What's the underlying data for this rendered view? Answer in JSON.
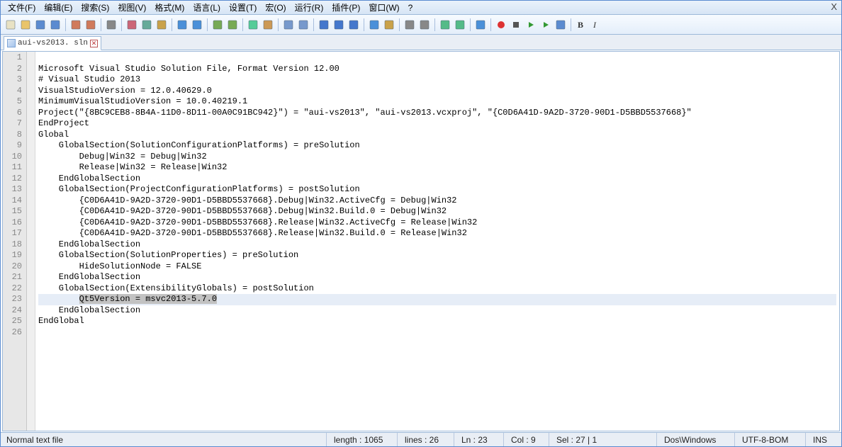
{
  "menu": [
    "文件(F)",
    "编辑(E)",
    "搜索(S)",
    "视图(V)",
    "格式(M)",
    "语言(L)",
    "设置(T)",
    "宏(O)",
    "运行(R)",
    "插件(P)",
    "窗口(W)",
    "?"
  ],
  "close_x": "X",
  "tab": {
    "name": "aui-vs2013. sln"
  },
  "toolbar_icons": [
    "new",
    "open",
    "save",
    "saveall",
    "sep",
    "close",
    "closeall",
    "sep",
    "print",
    "sep",
    "cut",
    "copy",
    "paste",
    "sep",
    "undo",
    "redo",
    "sep",
    "find",
    "replace",
    "sep",
    "zoomin",
    "zoomout",
    "sep",
    "syncv",
    "synch",
    "sep",
    "wrap",
    "invis",
    "indent",
    "sep",
    "lang",
    "folder",
    "sep",
    "fold1",
    "fold2",
    "sep",
    "comment",
    "comment2",
    "sep",
    "eye",
    "sep",
    "rec",
    "stop",
    "play",
    "playfast",
    "save-macro",
    "sep",
    "bold",
    "italic"
  ],
  "code_lines": [
    "",
    "Microsoft Visual Studio Solution File, Format Version 12.00",
    "# Visual Studio 2013",
    "VisualStudioVersion = 12.0.40629.0",
    "MinimumVisualStudioVersion = 10.0.40219.1",
    "Project(\"{8BC9CEB8-8B4A-11D0-8D11-00A0C91BC942}\") = \"aui-vs2013\", \"aui-vs2013.vcxproj\", \"{C0D6A41D-9A2D-3720-90D1-D5BBD5537668}\"",
    "EndProject",
    "Global",
    "    GlobalSection(SolutionConfigurationPlatforms) = preSolution",
    "        Debug|Win32 = Debug|Win32",
    "        Release|Win32 = Release|Win32",
    "    EndGlobalSection",
    "    GlobalSection(ProjectConfigurationPlatforms) = postSolution",
    "        {C0D6A41D-9A2D-3720-90D1-D5BBD5537668}.Debug|Win32.ActiveCfg = Debug|Win32",
    "        {C0D6A41D-9A2D-3720-90D1-D5BBD5537668}.Debug|Win32.Build.0 = Debug|Win32",
    "        {C0D6A41D-9A2D-3720-90D1-D5BBD5537668}.Release|Win32.ActiveCfg = Release|Win32",
    "        {C0D6A41D-9A2D-3720-90D1-D5BBD5537668}.Release|Win32.Build.0 = Release|Win32",
    "    EndGlobalSection",
    "    GlobalSection(SolutionProperties) = preSolution",
    "        HideSolutionNode = FALSE",
    "    EndGlobalSection",
    "    GlobalSection(ExtensibilityGlobals) = postSolution",
    "        Qt5Version = msvc2013-5.7.0",
    "    EndGlobalSection",
    "EndGlobal",
    ""
  ],
  "highlight_line_index": 22,
  "selection": {
    "line": 22,
    "text": "Qt5Version = msvc2013-5.7.0"
  },
  "status": {
    "filetype": "Normal text file",
    "length": "length : 1065",
    "lines": "lines : 26",
    "ln": "Ln : 23",
    "col": "Col : 9",
    "sel": "Sel : 27 | 1",
    "eol": "Dos\\Windows",
    "encoding": "UTF-8-BOM",
    "ins": "INS"
  }
}
